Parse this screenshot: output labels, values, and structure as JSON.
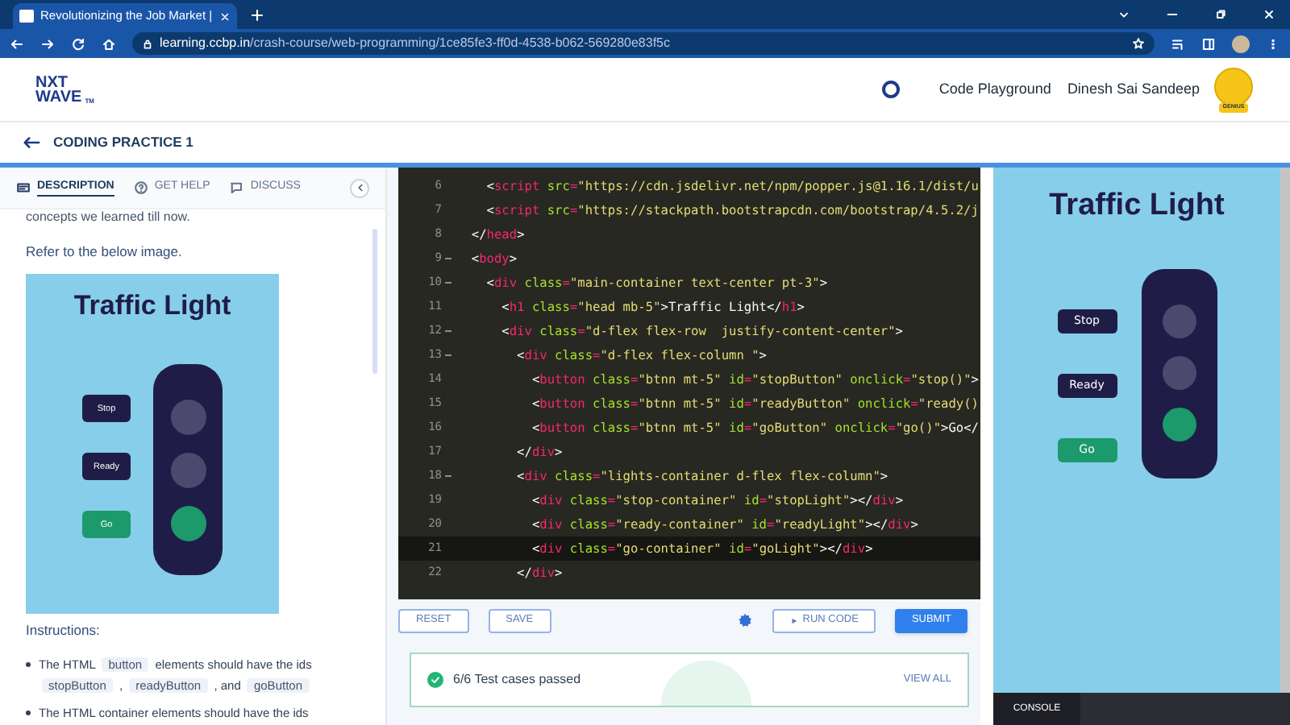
{
  "browser": {
    "tab_title": "Revolutionizing the Job Market |",
    "url_host": "learning.ccbp.in",
    "url_path": "/crash-course/web-programming/1ce85fe3-ff0d-4538-b062-569280e83f5c"
  },
  "header": {
    "logo_top": "NXT",
    "logo_bottom": "WAVE",
    "logo_mark": "TM",
    "nav_link": "Code Playground",
    "user_name": "Dinesh Sai Sandeep",
    "avatar_badge": "GENIUS"
  },
  "page_title": "CODING PRACTICE 1",
  "tabs": [
    {
      "label": "DESCRIPTION",
      "selected": true
    },
    {
      "label": "GET HELP",
      "selected": false
    },
    {
      "label": "DISCUSS",
      "selected": false
    }
  ],
  "description": {
    "intro": "concepts we learned till now.",
    "refer": "Refer to the below image.",
    "image": {
      "title": "Traffic Light",
      "buttons": [
        {
          "label": "Stop",
          "kind": "stop"
        },
        {
          "label": "Ready",
          "kind": "ready"
        },
        {
          "label": "Go",
          "kind": "go"
        }
      ],
      "lights": [
        {
          "on": false
        },
        {
          "on": false
        },
        {
          "on": true
        }
      ]
    },
    "instructions_heading": "Instructions:",
    "bullets": [
      [
        {
          "text": "The HTML",
          "kind": "text"
        },
        {
          "text": "button",
          "kind": "code"
        },
        {
          "text": "elements should have the ids",
          "kind": "text"
        },
        {
          "text": "stopButton",
          "kind": "code"
        },
        {
          "text": ",",
          "kind": "text"
        },
        {
          "text": "readyButton",
          "kind": "code"
        },
        {
          "text": ", and",
          "kind": "text"
        },
        {
          "text": "goButton",
          "kind": "code"
        }
      ],
      [
        {
          "text": "The HTML container elements should have the ids",
          "kind": "text"
        }
      ]
    ]
  },
  "editor": {
    "lines": [
      {
        "number": "6",
        "foldable": false,
        "active": false,
        "tokens": [
          {
            "kind": "punct",
            "text": "    <"
          },
          {
            "kind": "tag",
            "text": "script"
          },
          {
            "kind": "attr",
            "text": " src"
          },
          {
            "kind": "tag",
            "text": "="
          },
          {
            "kind": "str",
            "text": "\"https://cdn.jsdelivr.net/npm/popper.js@1.16.1/dist/u"
          }
        ]
      },
      {
        "number": "7",
        "foldable": false,
        "active": false,
        "tokens": [
          {
            "kind": "punct",
            "text": "    <"
          },
          {
            "kind": "tag",
            "text": "script"
          },
          {
            "kind": "attr",
            "text": " src"
          },
          {
            "kind": "tag",
            "text": "="
          },
          {
            "kind": "str",
            "text": "\"https://stackpath.bootstrapcdn.com/bootstrap/4.5.2/j"
          }
        ]
      },
      {
        "number": "8",
        "foldable": false,
        "active": false,
        "tokens": [
          {
            "kind": "punct",
            "text": "  </"
          },
          {
            "kind": "tag",
            "text": "head"
          },
          {
            "kind": "punct",
            "text": ">"
          }
        ]
      },
      {
        "number": "9",
        "foldable": true,
        "active": false,
        "tokens": [
          {
            "kind": "punct",
            "text": "  <"
          },
          {
            "kind": "tag",
            "text": "body"
          },
          {
            "kind": "punct",
            "text": ">"
          }
        ]
      },
      {
        "number": "10",
        "foldable": true,
        "active": false,
        "tokens": [
          {
            "kind": "punct",
            "text": "    <"
          },
          {
            "kind": "tag",
            "text": "div"
          },
          {
            "kind": "attr",
            "text": " class"
          },
          {
            "kind": "tag",
            "text": "="
          },
          {
            "kind": "str",
            "text": "\"main-container text-center pt-3\""
          },
          {
            "kind": "punct",
            "text": ">"
          }
        ]
      },
      {
        "number": "11",
        "foldable": false,
        "active": false,
        "tokens": [
          {
            "kind": "punct",
            "text": "      <"
          },
          {
            "kind": "tag",
            "text": "h1"
          },
          {
            "kind": "attr",
            "text": " class"
          },
          {
            "kind": "tag",
            "text": "="
          },
          {
            "kind": "str",
            "text": "\"head mb-5\""
          },
          {
            "kind": "punct",
            "text": ">Traffic Light</"
          },
          {
            "kind": "tag",
            "text": "h1"
          },
          {
            "kind": "punct",
            "text": ">"
          }
        ]
      },
      {
        "number": "12",
        "foldable": true,
        "active": false,
        "tokens": [
          {
            "kind": "punct",
            "text": "      <"
          },
          {
            "kind": "tag",
            "text": "div"
          },
          {
            "kind": "attr",
            "text": " class"
          },
          {
            "kind": "tag",
            "text": "="
          },
          {
            "kind": "str",
            "text": "\"d-flex flex-row  justify-content-center\""
          },
          {
            "kind": "punct",
            "text": ">"
          }
        ]
      },
      {
        "number": "13",
        "foldable": true,
        "active": false,
        "tokens": [
          {
            "kind": "punct",
            "text": "        <"
          },
          {
            "kind": "tag",
            "text": "div"
          },
          {
            "kind": "attr",
            "text": " class"
          },
          {
            "kind": "tag",
            "text": "="
          },
          {
            "kind": "str",
            "text": "\"d-flex flex-column \""
          },
          {
            "kind": "punct",
            "text": ">"
          }
        ]
      },
      {
        "number": "14",
        "foldable": false,
        "active": false,
        "tokens": [
          {
            "kind": "punct",
            "text": "          <"
          },
          {
            "kind": "tag",
            "text": "button"
          },
          {
            "kind": "attr",
            "text": " class"
          },
          {
            "kind": "tag",
            "text": "="
          },
          {
            "kind": "str",
            "text": "\"btnn mt-5\""
          },
          {
            "kind": "attr",
            "text": " id"
          },
          {
            "kind": "tag",
            "text": "="
          },
          {
            "kind": "str",
            "text": "\"stopButton\""
          },
          {
            "kind": "attr",
            "text": " onclick"
          },
          {
            "kind": "tag",
            "text": "="
          },
          {
            "kind": "str",
            "text": "\"stop()\""
          },
          {
            "kind": "punct",
            "text": ">"
          }
        ]
      },
      {
        "number": "15",
        "foldable": false,
        "active": false,
        "tokens": [
          {
            "kind": "punct",
            "text": "          <"
          },
          {
            "kind": "tag",
            "text": "button"
          },
          {
            "kind": "attr",
            "text": " class"
          },
          {
            "kind": "tag",
            "text": "="
          },
          {
            "kind": "str",
            "text": "\"btnn mt-5\""
          },
          {
            "kind": "attr",
            "text": " id"
          },
          {
            "kind": "tag",
            "text": "="
          },
          {
            "kind": "str",
            "text": "\"readyButton\""
          },
          {
            "kind": "attr",
            "text": " onclick"
          },
          {
            "kind": "tag",
            "text": "="
          },
          {
            "kind": "str",
            "text": "\"ready()"
          }
        ]
      },
      {
        "number": "16",
        "foldable": false,
        "active": false,
        "tokens": [
          {
            "kind": "punct",
            "text": "          <"
          },
          {
            "kind": "tag",
            "text": "button"
          },
          {
            "kind": "attr",
            "text": " class"
          },
          {
            "kind": "tag",
            "text": "="
          },
          {
            "kind": "str",
            "text": "\"btnn mt-5\""
          },
          {
            "kind": "attr",
            "text": " id"
          },
          {
            "kind": "tag",
            "text": "="
          },
          {
            "kind": "str",
            "text": "\"goButton\""
          },
          {
            "kind": "attr",
            "text": " onclick"
          },
          {
            "kind": "tag",
            "text": "="
          },
          {
            "kind": "str",
            "text": "\"go()\""
          },
          {
            "kind": "punct",
            "text": ">Go</"
          }
        ]
      },
      {
        "number": "17",
        "foldable": false,
        "active": false,
        "tokens": [
          {
            "kind": "punct",
            "text": "        </"
          },
          {
            "kind": "tag",
            "text": "div"
          },
          {
            "kind": "punct",
            "text": ">"
          }
        ]
      },
      {
        "number": "18",
        "foldable": true,
        "active": false,
        "tokens": [
          {
            "kind": "punct",
            "text": "        <"
          },
          {
            "kind": "tag",
            "text": "div"
          },
          {
            "kind": "attr",
            "text": " class"
          },
          {
            "kind": "tag",
            "text": "="
          },
          {
            "kind": "str",
            "text": "\"lights-container d-flex flex-column\""
          },
          {
            "kind": "punct",
            "text": ">"
          }
        ]
      },
      {
        "number": "19",
        "foldable": false,
        "active": false,
        "tokens": [
          {
            "kind": "punct",
            "text": "          <"
          },
          {
            "kind": "tag",
            "text": "div"
          },
          {
            "kind": "attr",
            "text": " class"
          },
          {
            "kind": "tag",
            "text": "="
          },
          {
            "kind": "str",
            "text": "\"stop-container\""
          },
          {
            "kind": "attr",
            "text": " id"
          },
          {
            "kind": "tag",
            "text": "="
          },
          {
            "kind": "str",
            "text": "\"stopLight\""
          },
          {
            "kind": "punct",
            "text": "></"
          },
          {
            "kind": "tag",
            "text": "div"
          },
          {
            "kind": "punct",
            "text": ">"
          }
        ]
      },
      {
        "number": "20",
        "foldable": false,
        "active": false,
        "tokens": [
          {
            "kind": "punct",
            "text": "          <"
          },
          {
            "kind": "tag",
            "text": "div"
          },
          {
            "kind": "attr",
            "text": " class"
          },
          {
            "kind": "tag",
            "text": "="
          },
          {
            "kind": "str",
            "text": "\"ready-container\""
          },
          {
            "kind": "attr",
            "text": " id"
          },
          {
            "kind": "tag",
            "text": "="
          },
          {
            "kind": "str",
            "text": "\"readyLight\""
          },
          {
            "kind": "punct",
            "text": "></"
          },
          {
            "kind": "tag",
            "text": "div"
          },
          {
            "kind": "punct",
            "text": ">"
          }
        ]
      },
      {
        "number": "21",
        "foldable": false,
        "active": true,
        "tokens": [
          {
            "kind": "punct",
            "text": "          <"
          },
          {
            "kind": "tag",
            "text": "div"
          },
          {
            "kind": "attr",
            "text": " class"
          },
          {
            "kind": "tag",
            "text": "="
          },
          {
            "kind": "str",
            "text": "\"go-container\""
          },
          {
            "kind": "attr",
            "text": " id"
          },
          {
            "kind": "tag",
            "text": "="
          },
          {
            "kind": "str",
            "text": "\"goLight\""
          },
          {
            "kind": "punct",
            "text": "></"
          },
          {
            "kind": "tag",
            "text": "div"
          },
          {
            "kind": "punct",
            "text": ">"
          }
        ]
      },
      {
        "number": "22",
        "foldable": false,
        "active": false,
        "tokens": [
          {
            "kind": "punct",
            "text": "        </"
          },
          {
            "kind": "tag",
            "text": "div"
          },
          {
            "kind": "punct",
            "text": ">"
          }
        ]
      }
    ],
    "buttons": [
      {
        "label": "RESET",
        "kind": "outline"
      },
      {
        "label": "SAVE",
        "kind": "outline"
      },
      {
        "label": "RUN CODE",
        "kind": "run"
      },
      {
        "label": "SUBMIT",
        "kind": "primary"
      }
    ],
    "result": {
      "text": "6/6 Test cases passed",
      "link": "VIEW ALL"
    }
  },
  "preview": {
    "title": "Traffic Light",
    "buttons": [
      {
        "label": "Stop",
        "kind": "stop"
      },
      {
        "label": "Ready",
        "kind": "ready"
      },
      {
        "label": "Go",
        "kind": "go"
      }
    ],
    "lights": [
      {
        "on": false
      },
      {
        "on": false
      },
      {
        "on": true
      }
    ],
    "console_tab": "CONSOLE"
  }
}
